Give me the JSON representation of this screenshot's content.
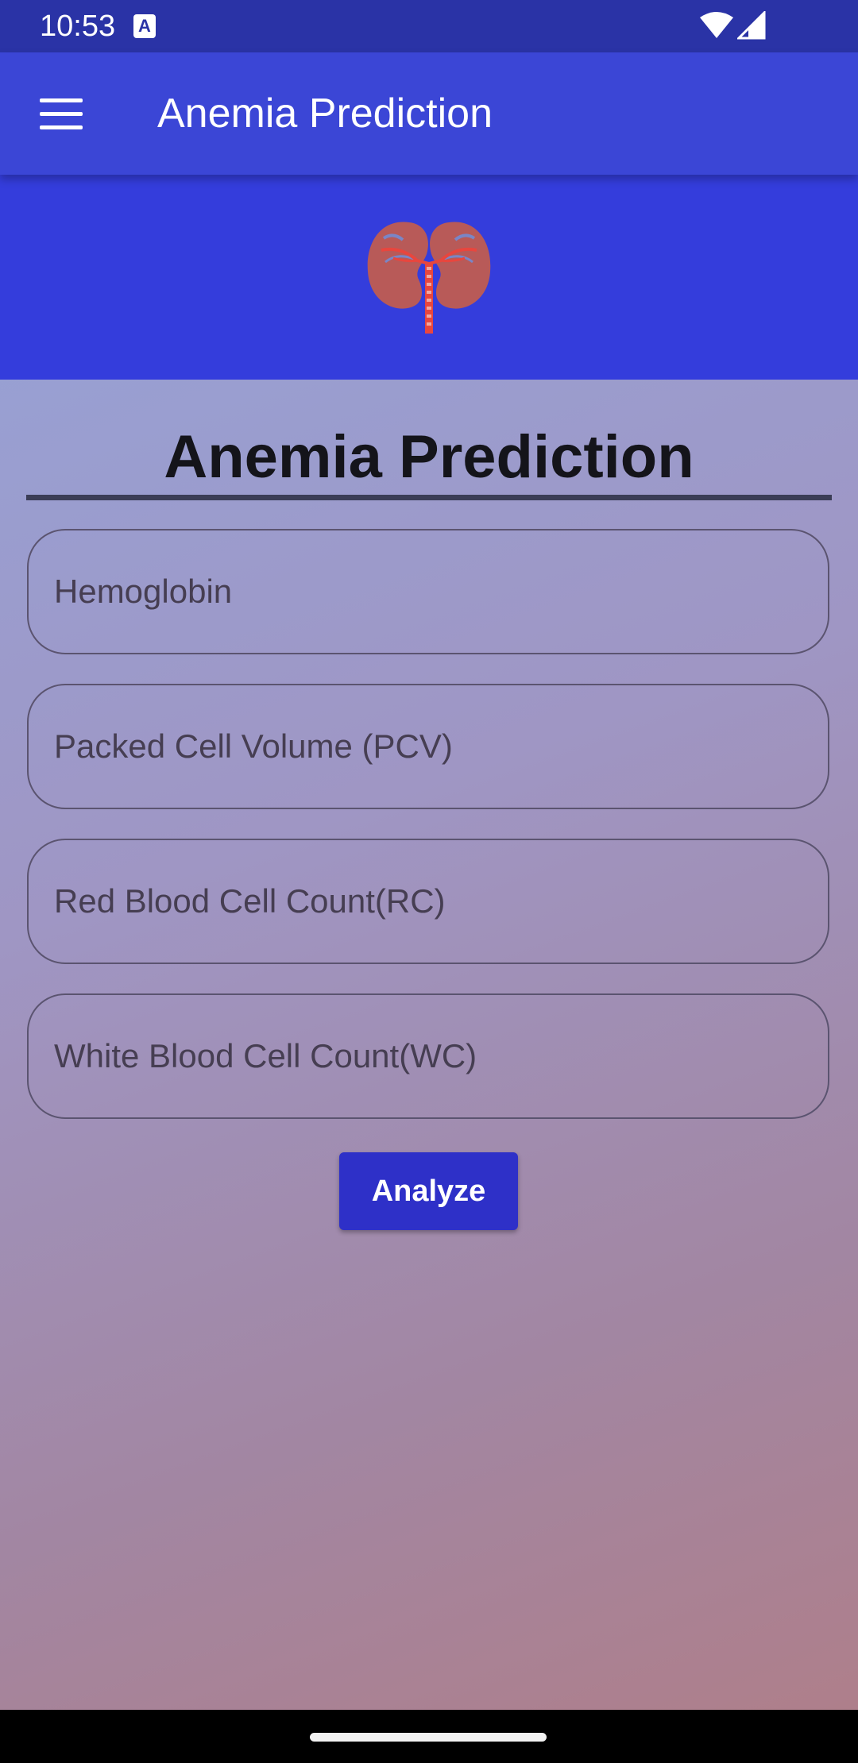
{
  "status_bar": {
    "time": "10:53",
    "notification_icon": "A",
    "icons": [
      "wifi-icon",
      "cellular-signal-icon"
    ]
  },
  "app_bar": {
    "title": "Anemia Prediction",
    "menu_icon": "hamburger-menu-icon"
  },
  "banner": {
    "logo": "kidney-icon"
  },
  "main": {
    "heading": "Anemia Prediction",
    "fields": [
      {
        "placeholder": "Hemoglobin",
        "value": ""
      },
      {
        "placeholder": "Packed Cell Volume (PCV)",
        "value": ""
      },
      {
        "placeholder": "Red Blood Cell Count(RC)",
        "value": ""
      },
      {
        "placeholder": "White Blood Cell Count(WC)",
        "value": ""
      }
    ],
    "analyze_label": "Analyze"
  },
  "colors": {
    "status_bar": "#2a33a6",
    "app_bar": "#3b46d6",
    "banner": "#343ddc",
    "button": "#2e30c8"
  }
}
